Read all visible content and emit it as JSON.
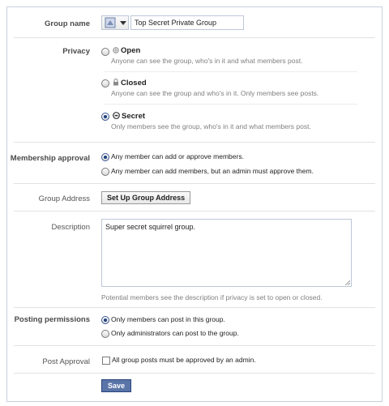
{
  "group_name": {
    "label": "Group name",
    "value": "Top Secret Private Group"
  },
  "privacy": {
    "label": "Privacy",
    "options": [
      {
        "title": "Open",
        "description": "Anyone can see the group, who's in it and what members post.",
        "selected": false
      },
      {
        "title": "Closed",
        "description": "Anyone can see the group and who's in it. Only members see posts.",
        "selected": false
      },
      {
        "title": "Secret",
        "description": "Only members see the group, who's in it and what members post.",
        "selected": true
      }
    ]
  },
  "membership_approval": {
    "label": "Membership approval",
    "options": [
      {
        "text": "Any member can add or approve members.",
        "selected": true
      },
      {
        "text": "Any member can add members, but an admin must approve them.",
        "selected": false
      }
    ]
  },
  "group_address": {
    "label": "Group Address",
    "button": "Set Up Group Address"
  },
  "description": {
    "label": "Description",
    "value": "Super secret squirrel group.",
    "hint": "Potential members see the description if privacy is set to open or closed."
  },
  "posting_permissions": {
    "label": "Posting permissions",
    "options": [
      {
        "text": "Only members can post in this group.",
        "selected": true
      },
      {
        "text": "Only administrators can post to the group.",
        "selected": false
      }
    ]
  },
  "post_approval": {
    "label": "Post Approval",
    "text": "All group posts must be approved by an admin.",
    "checked": false
  },
  "save_label": "Save",
  "colors": {
    "accent": "#3b5998",
    "save_bg": "#5b74a8",
    "border": "#c9cfdd",
    "muted_text": "#808080"
  }
}
